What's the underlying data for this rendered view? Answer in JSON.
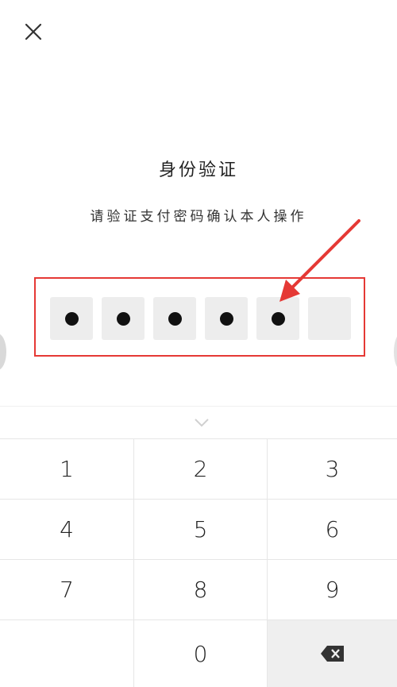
{
  "header": {
    "close_icon": "close-icon"
  },
  "dialog": {
    "title": "身份验证",
    "subtitle": "请验证支付密码确认本人操作"
  },
  "pin": {
    "length": 6,
    "filled": 5
  },
  "keypad": {
    "keys": [
      "1",
      "2",
      "3",
      "4",
      "5",
      "6",
      "7",
      "8",
      "9",
      "",
      "0",
      ""
    ],
    "delete_icon": "backspace-icon",
    "collapse_icon": "chevron-down-icon"
  },
  "colors": {
    "highlight": "#e53935",
    "pin_box": "#ededed",
    "delete_key_bg": "#efefef"
  }
}
